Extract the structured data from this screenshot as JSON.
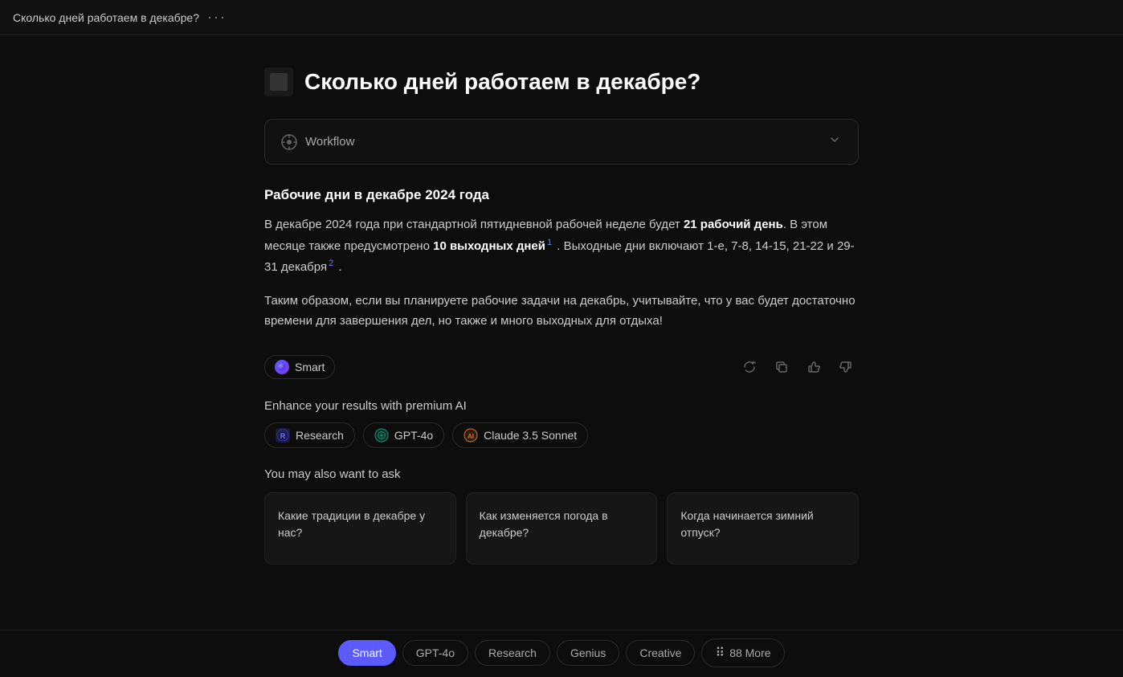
{
  "topbar": {
    "title": "Сколько дней работаем в декабре?",
    "dots": "···"
  },
  "question": {
    "title": "Сколько дней работаем в декабре?"
  },
  "workflow": {
    "label": "Workflow"
  },
  "answer": {
    "heading": "Рабочие дни в декабре 2024 года",
    "paragraph1_pre": "В декабре 2024 года при стандартной пятидневной рабочей неделе будет ",
    "paragraph1_bold1": "21 рабочий день",
    "paragraph1_mid": ". В этом месяце также предусмотрено ",
    "paragraph1_bold2": "10 выходных дней",
    "paragraph1_footnote1": "1",
    "paragraph1_post": " . Выходные дни включают 1-е, 7-8, 14-15, 21-22 и 29-31 декабря",
    "paragraph1_footnote2": "2",
    "paragraph1_end": " .",
    "paragraph2": "Таким образом, если вы планируете рабочие задачи на декабрь, учитывайте, что у вас будет достаточно времени для завершения дел, но также и много выходных для отдыха!"
  },
  "smart_badge": {
    "label": "Smart"
  },
  "enhance": {
    "title": "Enhance your results with premium AI",
    "chips": [
      {
        "id": "research",
        "label": "Research",
        "icon_type": "research"
      },
      {
        "id": "gpt4o",
        "label": "GPT-4o",
        "icon_type": "gpt"
      },
      {
        "id": "claude",
        "label": "Claude 3.5 Sonnet",
        "icon_type": "claude"
      }
    ]
  },
  "suggestions": {
    "title": "You may also want to ask",
    "items": [
      {
        "text": "Какие традиции в декабре у нас?"
      },
      {
        "text": "Как изменяется погода в декабре?"
      },
      {
        "text": "Когда начинается зимний отпуск?"
      }
    ]
  },
  "bottom_tabs": {
    "items": [
      {
        "id": "smart",
        "label": "Smart",
        "active": true
      },
      {
        "id": "gpt4o",
        "label": "GPT-4o",
        "active": false
      },
      {
        "id": "research",
        "label": "Research",
        "active": false
      },
      {
        "id": "genius",
        "label": "Genius",
        "active": false
      },
      {
        "id": "creative",
        "label": "Creative",
        "active": false
      },
      {
        "id": "more",
        "label": "88 More",
        "active": false
      }
    ]
  },
  "icons": {
    "workflow": "⚙",
    "chevron_down": "›",
    "refresh": "↺",
    "copy": "⧉",
    "thumbup": "👍",
    "thumbdown": "👎"
  }
}
